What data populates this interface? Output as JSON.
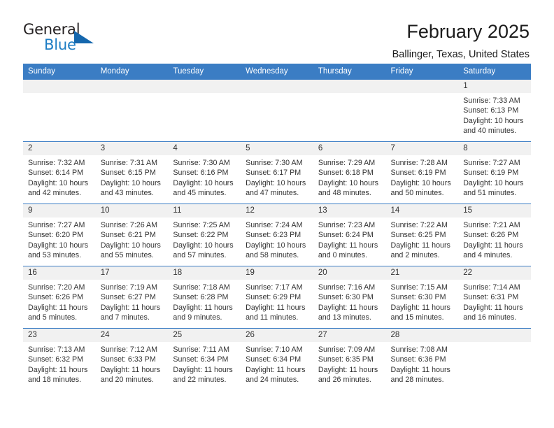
{
  "brand": {
    "name_part1": "General",
    "name_part2": "Blue",
    "accent_color": "#1f7ec4",
    "triangle_color": "#1567ad"
  },
  "header": {
    "title": "February 2025",
    "subtitle": "Ballinger, Texas, United States",
    "header_bg_color": "#3b7dc4",
    "band_bg_color": "#f1f1f1"
  },
  "weekday_headers": [
    "Sunday",
    "Monday",
    "Tuesday",
    "Wednesday",
    "Thursday",
    "Friday",
    "Saturday"
  ],
  "weeks": [
    [
      {
        "day": "",
        "sunrise": "",
        "sunset": "",
        "daylight_line1": "",
        "daylight_line2": ""
      },
      {
        "day": "",
        "sunrise": "",
        "sunset": "",
        "daylight_line1": "",
        "daylight_line2": ""
      },
      {
        "day": "",
        "sunrise": "",
        "sunset": "",
        "daylight_line1": "",
        "daylight_line2": ""
      },
      {
        "day": "",
        "sunrise": "",
        "sunset": "",
        "daylight_line1": "",
        "daylight_line2": ""
      },
      {
        "day": "",
        "sunrise": "",
        "sunset": "",
        "daylight_line1": "",
        "daylight_line2": ""
      },
      {
        "day": "",
        "sunrise": "",
        "sunset": "",
        "daylight_line1": "",
        "daylight_line2": ""
      },
      {
        "day": "1",
        "sunrise": "Sunrise: 7:33 AM",
        "sunset": "Sunset: 6:13 PM",
        "daylight_line1": "Daylight: 10 hours",
        "daylight_line2": "and 40 minutes."
      }
    ],
    [
      {
        "day": "2",
        "sunrise": "Sunrise: 7:32 AM",
        "sunset": "Sunset: 6:14 PM",
        "daylight_line1": "Daylight: 10 hours",
        "daylight_line2": "and 42 minutes."
      },
      {
        "day": "3",
        "sunrise": "Sunrise: 7:31 AM",
        "sunset": "Sunset: 6:15 PM",
        "daylight_line1": "Daylight: 10 hours",
        "daylight_line2": "and 43 minutes."
      },
      {
        "day": "4",
        "sunrise": "Sunrise: 7:30 AM",
        "sunset": "Sunset: 6:16 PM",
        "daylight_line1": "Daylight: 10 hours",
        "daylight_line2": "and 45 minutes."
      },
      {
        "day": "5",
        "sunrise": "Sunrise: 7:30 AM",
        "sunset": "Sunset: 6:17 PM",
        "daylight_line1": "Daylight: 10 hours",
        "daylight_line2": "and 47 minutes."
      },
      {
        "day": "6",
        "sunrise": "Sunrise: 7:29 AM",
        "sunset": "Sunset: 6:18 PM",
        "daylight_line1": "Daylight: 10 hours",
        "daylight_line2": "and 48 minutes."
      },
      {
        "day": "7",
        "sunrise": "Sunrise: 7:28 AM",
        "sunset": "Sunset: 6:19 PM",
        "daylight_line1": "Daylight: 10 hours",
        "daylight_line2": "and 50 minutes."
      },
      {
        "day": "8",
        "sunrise": "Sunrise: 7:27 AM",
        "sunset": "Sunset: 6:19 PM",
        "daylight_line1": "Daylight: 10 hours",
        "daylight_line2": "and 51 minutes."
      }
    ],
    [
      {
        "day": "9",
        "sunrise": "Sunrise: 7:27 AM",
        "sunset": "Sunset: 6:20 PM",
        "daylight_line1": "Daylight: 10 hours",
        "daylight_line2": "and 53 minutes."
      },
      {
        "day": "10",
        "sunrise": "Sunrise: 7:26 AM",
        "sunset": "Sunset: 6:21 PM",
        "daylight_line1": "Daylight: 10 hours",
        "daylight_line2": "and 55 minutes."
      },
      {
        "day": "11",
        "sunrise": "Sunrise: 7:25 AM",
        "sunset": "Sunset: 6:22 PM",
        "daylight_line1": "Daylight: 10 hours",
        "daylight_line2": "and 57 minutes."
      },
      {
        "day": "12",
        "sunrise": "Sunrise: 7:24 AM",
        "sunset": "Sunset: 6:23 PM",
        "daylight_line1": "Daylight: 10 hours",
        "daylight_line2": "and 58 minutes."
      },
      {
        "day": "13",
        "sunrise": "Sunrise: 7:23 AM",
        "sunset": "Sunset: 6:24 PM",
        "daylight_line1": "Daylight: 11 hours",
        "daylight_line2": "and 0 minutes."
      },
      {
        "day": "14",
        "sunrise": "Sunrise: 7:22 AM",
        "sunset": "Sunset: 6:25 PM",
        "daylight_line1": "Daylight: 11 hours",
        "daylight_line2": "and 2 minutes."
      },
      {
        "day": "15",
        "sunrise": "Sunrise: 7:21 AM",
        "sunset": "Sunset: 6:26 PM",
        "daylight_line1": "Daylight: 11 hours",
        "daylight_line2": "and 4 minutes."
      }
    ],
    [
      {
        "day": "16",
        "sunrise": "Sunrise: 7:20 AM",
        "sunset": "Sunset: 6:26 PM",
        "daylight_line1": "Daylight: 11 hours",
        "daylight_line2": "and 5 minutes."
      },
      {
        "day": "17",
        "sunrise": "Sunrise: 7:19 AM",
        "sunset": "Sunset: 6:27 PM",
        "daylight_line1": "Daylight: 11 hours",
        "daylight_line2": "and 7 minutes."
      },
      {
        "day": "18",
        "sunrise": "Sunrise: 7:18 AM",
        "sunset": "Sunset: 6:28 PM",
        "daylight_line1": "Daylight: 11 hours",
        "daylight_line2": "and 9 minutes."
      },
      {
        "day": "19",
        "sunrise": "Sunrise: 7:17 AM",
        "sunset": "Sunset: 6:29 PM",
        "daylight_line1": "Daylight: 11 hours",
        "daylight_line2": "and 11 minutes."
      },
      {
        "day": "20",
        "sunrise": "Sunrise: 7:16 AM",
        "sunset": "Sunset: 6:30 PM",
        "daylight_line1": "Daylight: 11 hours",
        "daylight_line2": "and 13 minutes."
      },
      {
        "day": "21",
        "sunrise": "Sunrise: 7:15 AM",
        "sunset": "Sunset: 6:30 PM",
        "daylight_line1": "Daylight: 11 hours",
        "daylight_line2": "and 15 minutes."
      },
      {
        "day": "22",
        "sunrise": "Sunrise: 7:14 AM",
        "sunset": "Sunset: 6:31 PM",
        "daylight_line1": "Daylight: 11 hours",
        "daylight_line2": "and 16 minutes."
      }
    ],
    [
      {
        "day": "23",
        "sunrise": "Sunrise: 7:13 AM",
        "sunset": "Sunset: 6:32 PM",
        "daylight_line1": "Daylight: 11 hours",
        "daylight_line2": "and 18 minutes."
      },
      {
        "day": "24",
        "sunrise": "Sunrise: 7:12 AM",
        "sunset": "Sunset: 6:33 PM",
        "daylight_line1": "Daylight: 11 hours",
        "daylight_line2": "and 20 minutes."
      },
      {
        "day": "25",
        "sunrise": "Sunrise: 7:11 AM",
        "sunset": "Sunset: 6:34 PM",
        "daylight_line1": "Daylight: 11 hours",
        "daylight_line2": "and 22 minutes."
      },
      {
        "day": "26",
        "sunrise": "Sunrise: 7:10 AM",
        "sunset": "Sunset: 6:34 PM",
        "daylight_line1": "Daylight: 11 hours",
        "daylight_line2": "and 24 minutes."
      },
      {
        "day": "27",
        "sunrise": "Sunrise: 7:09 AM",
        "sunset": "Sunset: 6:35 PM",
        "daylight_line1": "Daylight: 11 hours",
        "daylight_line2": "and 26 minutes."
      },
      {
        "day": "28",
        "sunrise": "Sunrise: 7:08 AM",
        "sunset": "Sunset: 6:36 PM",
        "daylight_line1": "Daylight: 11 hours",
        "daylight_line2": "and 28 minutes."
      },
      {
        "day": "",
        "sunrise": "",
        "sunset": "",
        "daylight_line1": "",
        "daylight_line2": ""
      }
    ]
  ]
}
